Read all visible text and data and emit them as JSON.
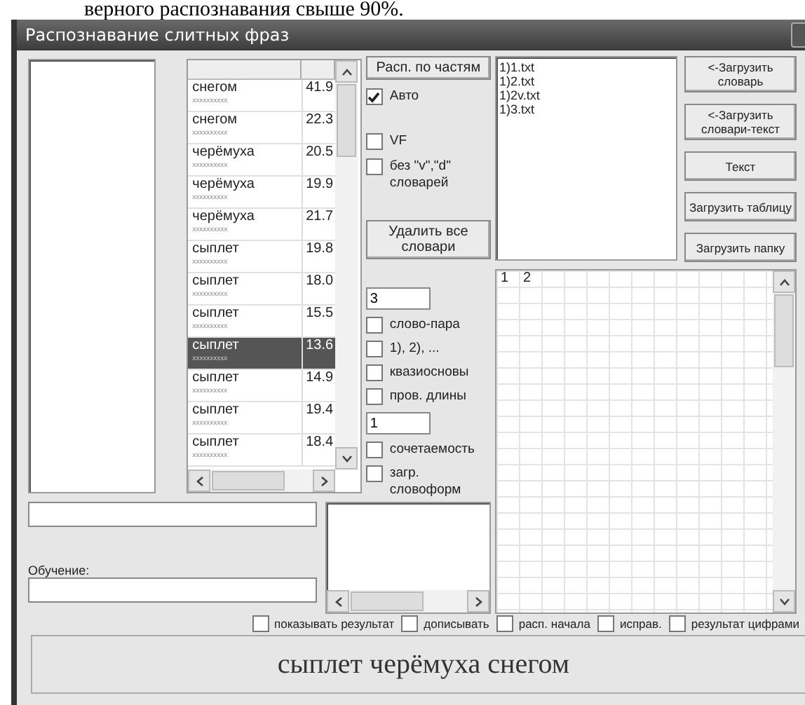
{
  "background_text": "верного распознавания свыше 90%.",
  "window": {
    "title": "Распознавание слитных фраз"
  },
  "table": {
    "rows": [
      {
        "word": "снегом",
        "sub": "xxxxxxxxxx",
        "score": "41.9",
        "selected": false
      },
      {
        "word": "снегом",
        "sub": "xxxxxxxxxx",
        "score": "22.3",
        "selected": false
      },
      {
        "word": "черёмуха",
        "sub": "xxxxxxxxxx",
        "score": "20.5",
        "selected": false
      },
      {
        "word": "черёмуха",
        "sub": "xxxxxxxxxx",
        "score": "19.9",
        "selected": false
      },
      {
        "word": "черёмуха",
        "sub": "xxxxxxxxxx",
        "score": "21.7",
        "selected": false
      },
      {
        "word": "сыплет",
        "sub": "xxxxxxxxxx",
        "score": "19.8",
        "selected": false
      },
      {
        "word": "сыплет",
        "sub": "xxxxxxxxxx",
        "score": "18.0",
        "selected": false
      },
      {
        "word": "сыплет",
        "sub": "xxxxxxxxxx",
        "score": "15.5",
        "selected": false
      },
      {
        "word": "сыплет",
        "sub": "xxxxxxxxxx",
        "score": "13.6",
        "selected": true
      },
      {
        "word": "сыплет",
        "sub": "xxxxxxxxxx",
        "score": "14.9",
        "selected": false
      },
      {
        "word": "сыплет",
        "sub": "xxxxxxxxxx",
        "score": "19.4",
        "selected": false
      },
      {
        "word": "сыплет",
        "sub": "xxxxxxxxxx",
        "score": "18.4",
        "selected": false
      }
    ]
  },
  "control_groups": [
    [
      {
        "kind": "button",
        "label": "Расп. по частям"
      },
      {
        "kind": "checkbox",
        "label": "Авто",
        "checked": true
      }
    ],
    [
      {
        "kind": "checkbox",
        "label": "VF",
        "checked": false
      },
      {
        "kind": "checkbox",
        "label": "без \"v\",\"d\" словарей",
        "checked": false
      }
    ],
    [
      {
        "kind": "button",
        "label": "Удалить все словари"
      }
    ],
    [
      {
        "kind": "input",
        "value": "3"
      },
      {
        "kind": "checkbox",
        "label": "слово-пара",
        "checked": false
      },
      {
        "kind": "checkbox",
        "label": "1), 2), ...",
        "checked": false
      },
      {
        "kind": "checkbox",
        "label": "квазиосновы",
        "checked": false
      },
      {
        "kind": "checkbox",
        "label": "пров. длины",
        "checked": false
      },
      {
        "kind": "input",
        "value": "1"
      },
      {
        "kind": "checkbox",
        "label": "сочетаемость",
        "checked": false
      },
      {
        "kind": "checkbox",
        "label": "загр. словоформ",
        "checked": false
      }
    ]
  ],
  "files": [
    "1)1.txt",
    "1)2.txt",
    "1)2v.txt",
    "1)3.txt"
  ],
  "right_buttons": [
    "<-Загрузить словарь",
    "<-Загрузить словари-текст",
    "Текст",
    "Загрузить таблицу",
    "Загрузить папку"
  ],
  "grid": {
    "headers": [
      "1",
      "2"
    ]
  },
  "training": {
    "label": "Обучение:"
  },
  "options": [
    {
      "label": "показывать результат",
      "checked": false
    },
    {
      "label": "дописывать",
      "checked": false
    },
    {
      "label": "расп. начала",
      "checked": false
    },
    {
      "label": "исправ.",
      "checked": false
    },
    {
      "label": "результат цифрами",
      "checked": false
    }
  ],
  "result": "сыплет черёмуха снегом"
}
